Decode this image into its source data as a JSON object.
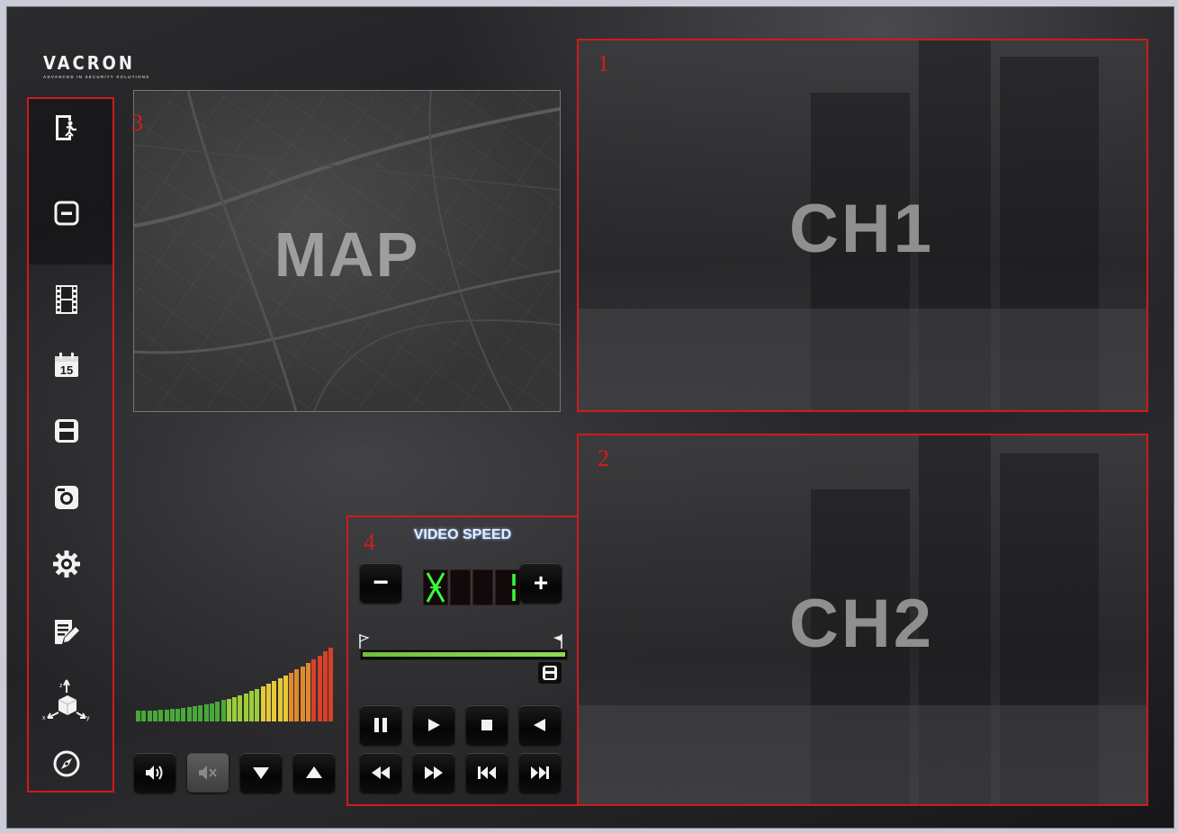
{
  "logo": {
    "brand": "VACRON",
    "tagline": "ADVANCED IN SECURITY SOLUTIONS"
  },
  "sidebar": {
    "items": [
      {
        "name": "exit-icon"
      },
      {
        "name": "minimize-icon"
      },
      {
        "name": "film-icon"
      },
      {
        "name": "calendar-icon",
        "text": "15"
      },
      {
        "name": "save-icon"
      },
      {
        "name": "snapshot-icon"
      },
      {
        "name": "settings-gear-icon"
      },
      {
        "name": "edit-note-icon"
      },
      {
        "name": "gsensor-axis-icon",
        "axis_labels": [
          "z",
          "x",
          "y"
        ]
      },
      {
        "name": "compass-icon"
      }
    ]
  },
  "map": {
    "label": "MAP"
  },
  "channels": [
    {
      "label": "CH1"
    },
    {
      "label": "CH2"
    }
  ],
  "annotations": [
    "1",
    "2",
    "3",
    "4"
  ],
  "video_speed": {
    "title": "VIDEO SPEED",
    "minus_label": "−",
    "plus_label": "+",
    "progress": 1.0
  },
  "playback_controls": [
    "pause-icon",
    "play-icon",
    "stop-icon",
    "reverse-play-icon",
    "fast-rewind-icon",
    "fast-forward-icon",
    "skip-start-icon",
    "skip-end-icon"
  ],
  "audio_controls": [
    "volume-icon",
    "mute-icon",
    "volume-down-icon",
    "volume-up-icon"
  ],
  "colors": {
    "annotation_red": "#d01a1a",
    "progress_green": "#7fcf45",
    "digit_green": "#39ff3a"
  }
}
